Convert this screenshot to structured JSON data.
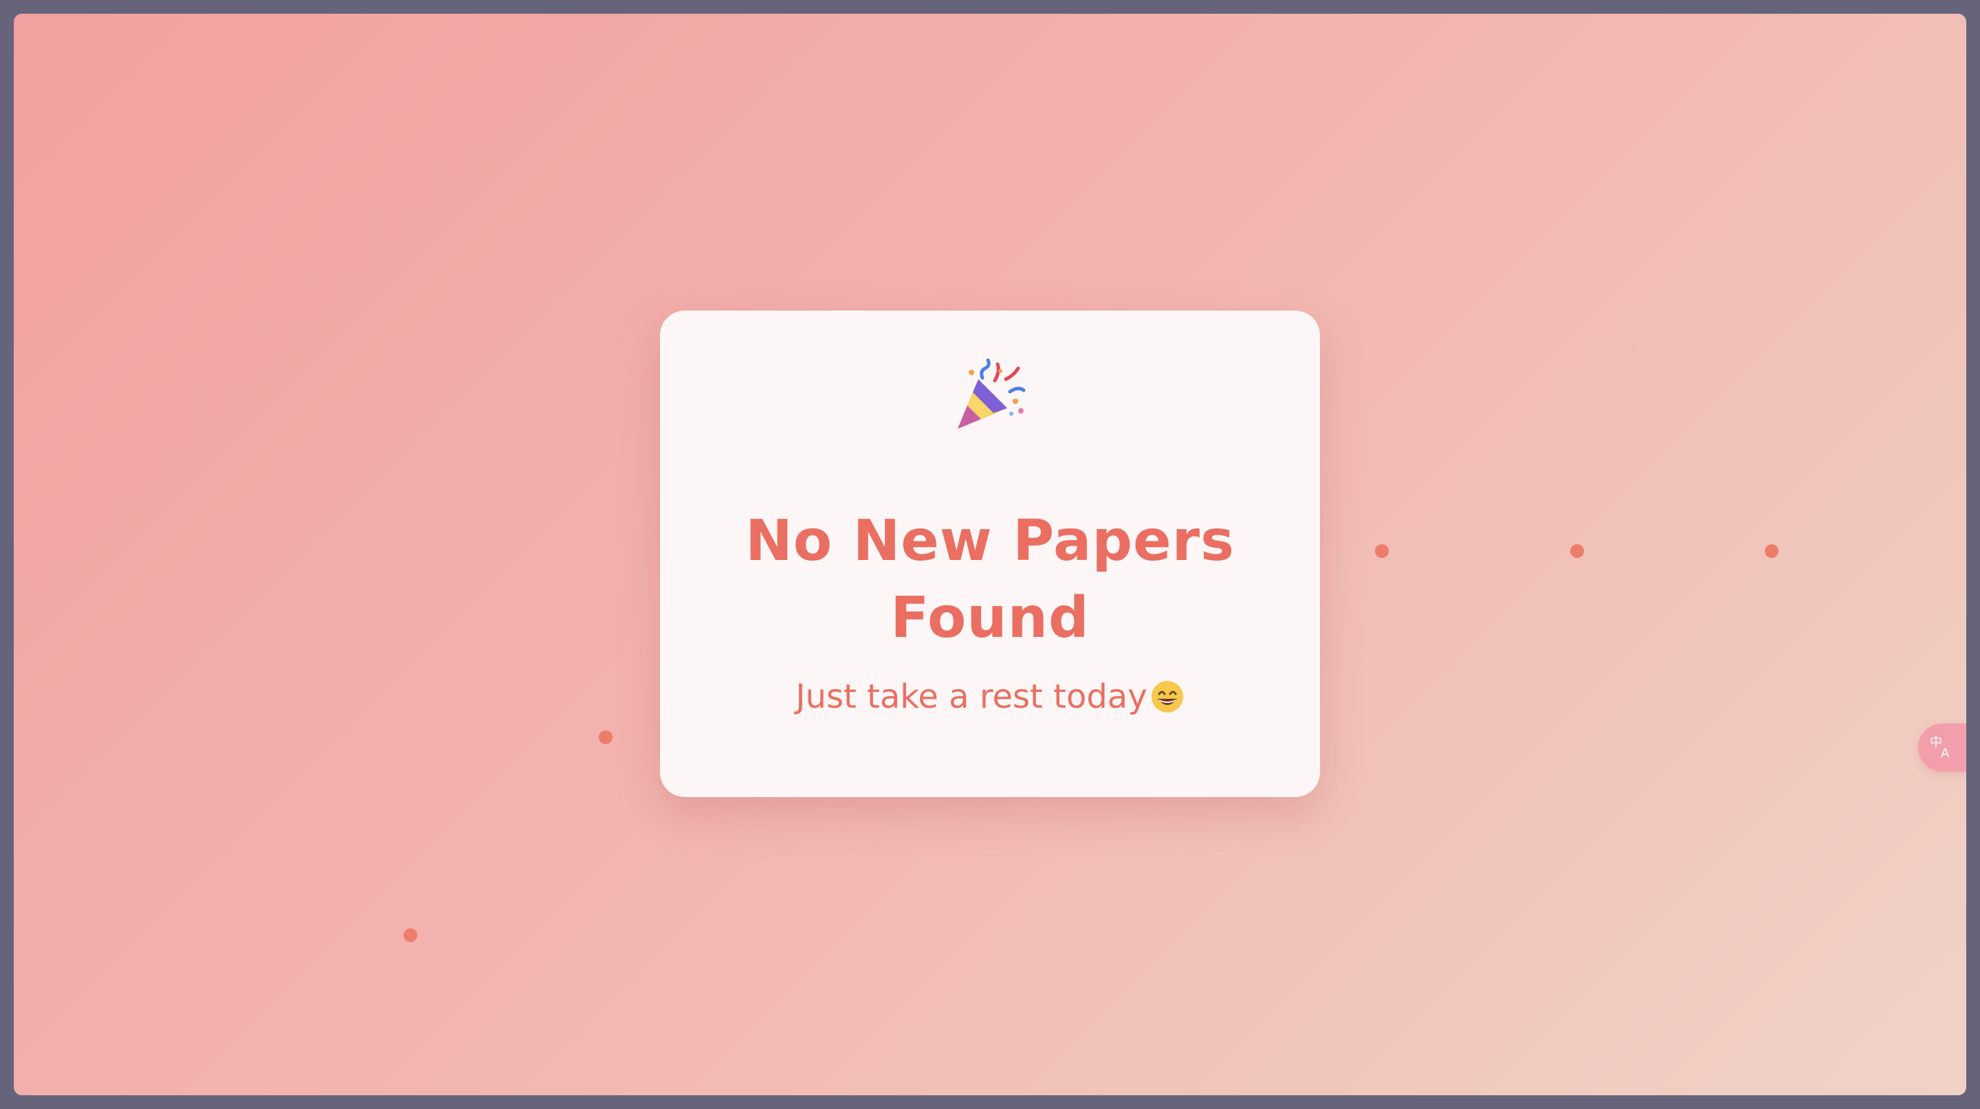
{
  "card": {
    "icon": "party-popper-icon",
    "title": "No New Papers Found",
    "subtitle": "Just take a rest today",
    "subtitle_icon": "grinning-face-icon"
  },
  "translate_button": {
    "icon": "translate-icon"
  },
  "colors": {
    "accent": "#ea6f62",
    "dot": "#ee7c6b",
    "card_bg": "#fcf6f6",
    "background_start": "#f3a0a0",
    "background_end": "#f1d2c7",
    "translate_button_bg": "#f29fab"
  }
}
